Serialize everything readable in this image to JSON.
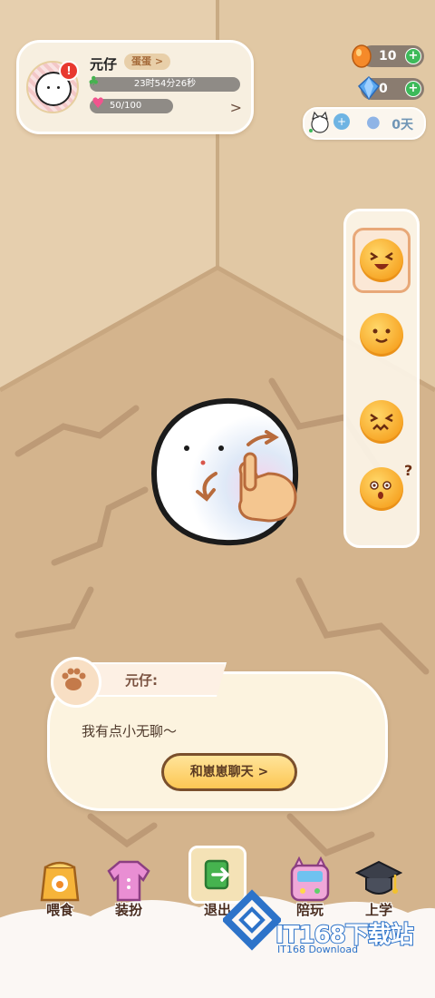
{
  "profile": {
    "name": "元仔",
    "stage_label": "蛋蛋 >",
    "alert": "!",
    "timer": "23时54分26秒",
    "health": "50/100",
    "arrow": ">"
  },
  "currency": {
    "eggs": "10",
    "gems": "0",
    "plus": "+"
  },
  "stats": {
    "days": "0天"
  },
  "emotions": [
    "happy",
    "smile",
    "upset",
    "confused"
  ],
  "dialog": {
    "speaker": "元仔:",
    "message": "我有点小无聊～",
    "chat_button": "和崽崽聊天 >"
  },
  "nav": {
    "feed": "喂食",
    "dress": "装扮",
    "exit": "退出",
    "play": "陪玩",
    "school": "上学"
  },
  "watermark": {
    "main": "IT168下载站",
    "sub": "IT168 Download"
  },
  "colors": {
    "wall": "#e2c9a7",
    "floor": "#d3b38c",
    "accent": "#fcc754",
    "health": "#f2548e",
    "plus": "#3dba5a"
  }
}
